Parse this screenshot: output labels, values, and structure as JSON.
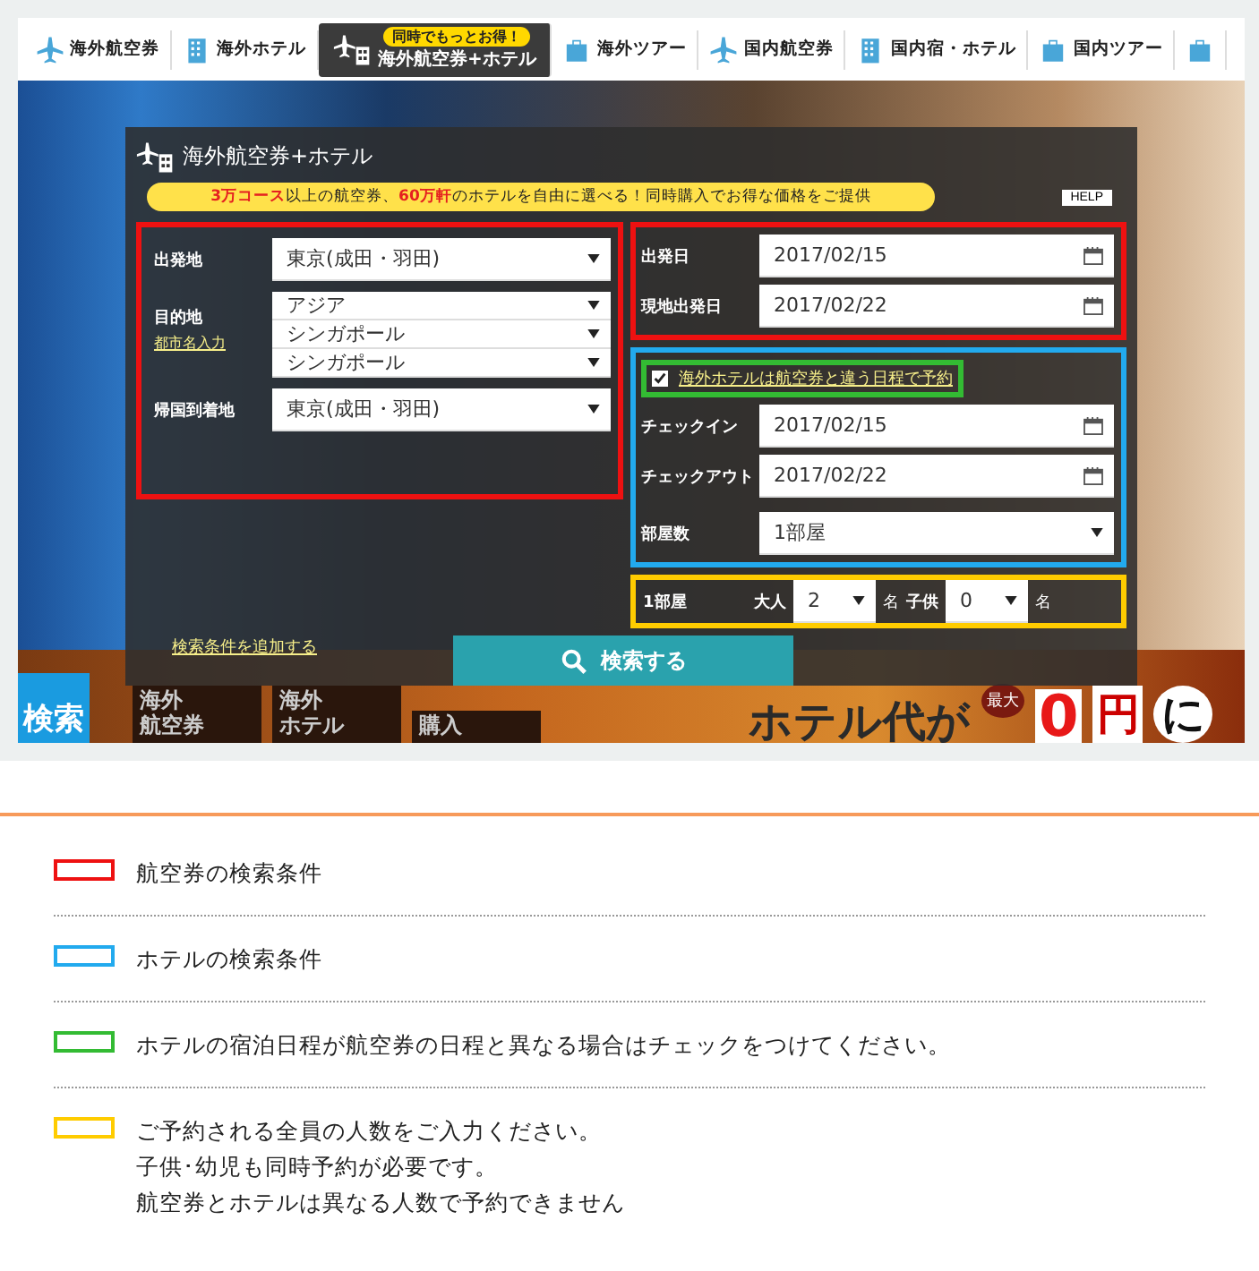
{
  "nav": [
    {
      "kind": "plane",
      "label": "海外航空券",
      "selected": false
    },
    {
      "kind": "building",
      "label": "海外ホテル",
      "selected": false
    },
    {
      "kind": "combo",
      "badge": "同時でもっとお得！",
      "label": "海外航空券+ホテル",
      "selected": true
    },
    {
      "kind": "suitcase",
      "label": "海外ツアー",
      "selected": false
    },
    {
      "kind": "plane",
      "label": "国内航空券",
      "selected": false
    },
    {
      "kind": "building",
      "label": "国内宿・ホテル",
      "selected": false
    },
    {
      "kind": "suitcase",
      "label": "国内ツアー",
      "selected": false
    },
    {
      "kind": "suitcase",
      "selected": false
    }
  ],
  "panel": {
    "title": "海外航空券+ホテル",
    "notice": "**3万コース**以上の航空券、**60万軒**のホテルを自由に選べる！同時購入でお得な価格をご提供",
    "help": "HELP"
  },
  "flight": {
    "departure": {
      "label": "出発地",
      "value": "東京(成田・羽田)"
    },
    "destination": {
      "label": "目的地",
      "link": "都市名入力",
      "values": [
        "アジア",
        "シンガポール",
        "シンガポール"
      ]
    },
    "return": {
      "label": "帰国到着地",
      "value": "東京(成田・羽田)"
    },
    "dates": [
      {
        "label": "出発日",
        "value": "2017/02/15"
      },
      {
        "label": "現地出発日",
        "value": "2017/02/22"
      }
    ]
  },
  "hotel": {
    "different_dates": {
      "label": "海外ホテルは航空券と違う日程で予約",
      "checked": true
    },
    "dates": [
      {
        "label": "チェックイン",
        "value": "2017/02/15"
      },
      {
        "label": "チェックアウト",
        "value": "2017/02/22"
      }
    ],
    "rooms": {
      "label": "部屋数",
      "value": "1部屋"
    }
  },
  "guests": {
    "room": "1部屋",
    "adults_label": "大人",
    "adults": "2",
    "adults_unit": "名",
    "children_label": "子供",
    "children": "0",
    "children_unit": "名"
  },
  "add_conditions": "検索条件を追加する",
  "search_button": "検索する",
  "banner": {
    "tag": "検索",
    "items": [
      [
        "海外",
        "航空券"
      ],
      [
        "海外",
        "ホテル"
      ],
      [
        "購入"
      ]
    ],
    "headline": "ホテル代が",
    "small": "最大",
    "amount": "0",
    "yen": "円",
    "tail": "に"
  },
  "legend": [
    {
      "color": "#ee1111",
      "lines": [
        "航空券の検索条件"
      ]
    },
    {
      "color": "#22aaee",
      "lines": [
        "ホテルの検索条件"
      ]
    },
    {
      "color": "#33bb33",
      "lines": [
        "ホテルの宿泊日程が航空券の日程と異なる場合はチェックをつけてください。"
      ]
    },
    {
      "color": "#ffcc00",
      "lines": [
        "ご予約される全員の人数をご入力ください。",
        "子供･幼児も同時予約が必要です。",
        "航空券とホテルは異なる人数で予約できません"
      ]
    }
  ]
}
